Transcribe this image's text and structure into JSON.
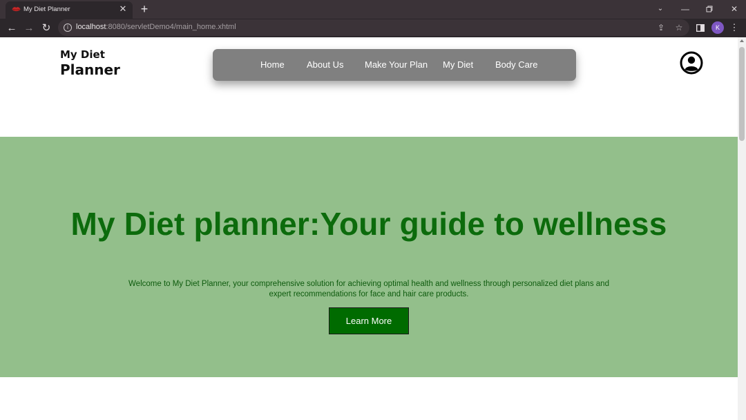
{
  "browser": {
    "tab_title": "My Diet Planner",
    "tab_close_icon": "close-icon",
    "new_tab_icon": "plus-icon",
    "url_host": "localhost",
    "url_path": ":8080/servletDemo4/main_home.xhtml",
    "profile_initial": "K",
    "icons": [
      "back-arrow-icon",
      "forward-arrow-icon",
      "reload-icon",
      "info-icon",
      "share-icon",
      "star-icon",
      "side-panel-icon",
      "kebab-menu-icon"
    ],
    "window_controls": [
      "chevron-down-icon",
      "minimize-icon",
      "restore-icon",
      "close-icon"
    ]
  },
  "page": {
    "brand_line1": "My Diet",
    "brand_line2": "Planner",
    "nav": [
      "Home",
      "About Us",
      "Make Your Plan",
      "My Diet",
      "Body Care"
    ],
    "profile_icon": "user-circle-icon",
    "hero": {
      "title": "My Diet planner:Your guide to wellness",
      "description_line1": "Welcome to My Diet Planner, your comprehensive solution for achieving optimal health and wellness through personalized diet plans and",
      "description_line2": "expert recommendations for face and hair care products.",
      "button_label": "Learn More"
    }
  },
  "colors": {
    "hero_background": "#93bf8b",
    "hero_title": "#0c6b0c",
    "button_background": "#006b00",
    "navbar_background": "#808080"
  }
}
